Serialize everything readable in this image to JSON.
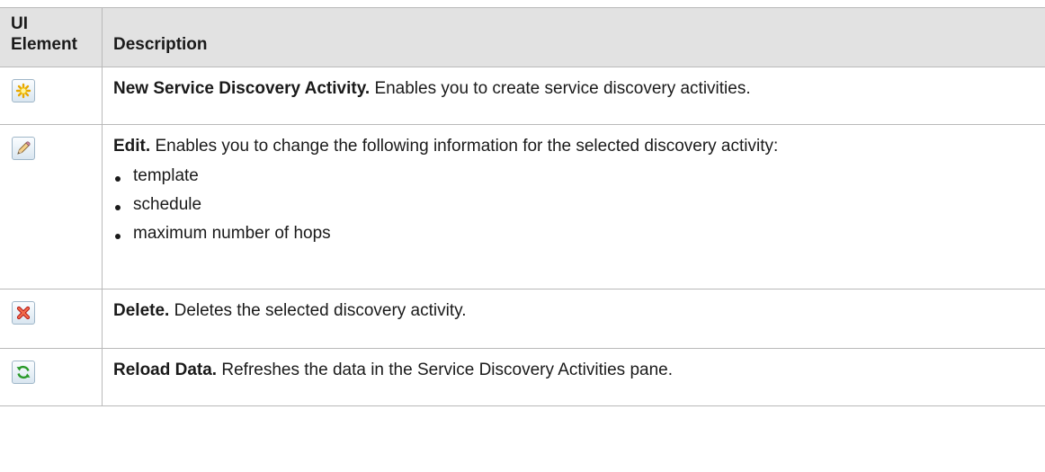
{
  "header": {
    "ui_element": "UI Element",
    "description": "Description"
  },
  "rows": [
    {
      "icon": "new-activity-icon",
      "name": "New Service Discovery Activity.",
      "text": "Enables you to create service discovery activities."
    },
    {
      "icon": "edit-pencil-icon",
      "name": "Edit.",
      "text": "Enables you to change the following information for the selected discovery activity:",
      "bullets": [
        "template",
        "schedule",
        "maximum number of hops"
      ]
    },
    {
      "icon": "delete-x-icon",
      "name": "Delete.",
      "text": "Deletes the selected discovery activity."
    },
    {
      "icon": "reload-icon",
      "name": "Reload Data.",
      "text": "Refreshes the data in the Service Discovery Activities pane."
    }
  ],
  "colors": {
    "header_bg": "#e2e2e2",
    "border": "#b9b9b9",
    "text": "#1a1a1a"
  }
}
